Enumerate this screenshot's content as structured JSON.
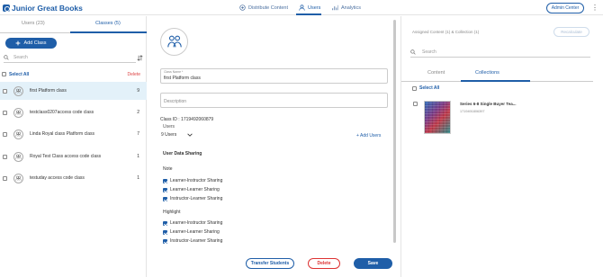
{
  "header": {
    "logo_text": "Junior Great Books",
    "nav": [
      {
        "label": "Distribute Content",
        "icon": "distribute-icon"
      },
      {
        "label": "Users",
        "icon": "user-icon"
      },
      {
        "label": "Analytics",
        "icon": "analytics-icon"
      }
    ],
    "admin_label": "Admin Center",
    "more_glyph": "⋮"
  },
  "left": {
    "tabs": [
      "Users (23)",
      "Classes (5)"
    ],
    "add_class": "Add Class",
    "search_placeholder": "Search",
    "select_all": "Select All",
    "delete": "Delete",
    "classes": [
      {
        "name": "first Platform class",
        "count": "9"
      },
      {
        "name": "testclass0207access code class",
        "count": "2"
      },
      {
        "name": "Linda Royal class Platform class",
        "count": "7"
      },
      {
        "name": "Royal Test Class access code class",
        "count": "1"
      },
      {
        "name": "testuday access code class",
        "count": "1"
      }
    ]
  },
  "middle": {
    "class_name_label": "Class Name *",
    "class_name_value": "first Platform class",
    "description_placeholder": "Description",
    "class_id": "Class ID : 1719492060879",
    "users_label": "Users",
    "users_value": "9 Users",
    "add_users": "+ Add Users",
    "data_sharing_title": "User Data Sharing",
    "note_title": "Note",
    "note_items": [
      "Learner-Instructor Sharing",
      "Learner-Learner Sharing",
      "Instructor-Learner Sharing"
    ],
    "highlight_title": "Highlight",
    "highlight_items": [
      "Learner-Instructor Sharing",
      "Learner-Learner Sharing",
      "Instructor-Learner Sharing"
    ],
    "transfer": "Transfer Students",
    "delete": "Delete",
    "save": "Save"
  },
  "right": {
    "assigned_title": "Assigned Content (1) & Collection (1)",
    "recalculate": "Recalculate",
    "search_placeholder": "Search",
    "tabs": [
      "Content",
      "Collections"
    ],
    "select_all": "Select All",
    "book_title": "Series 6-8 Single Buyer Tea...",
    "book_id": "1719491806397"
  },
  "colors": {
    "accent": "#1f5ea8",
    "selected_row": "#e3f1f9",
    "danger": "#d33333"
  }
}
